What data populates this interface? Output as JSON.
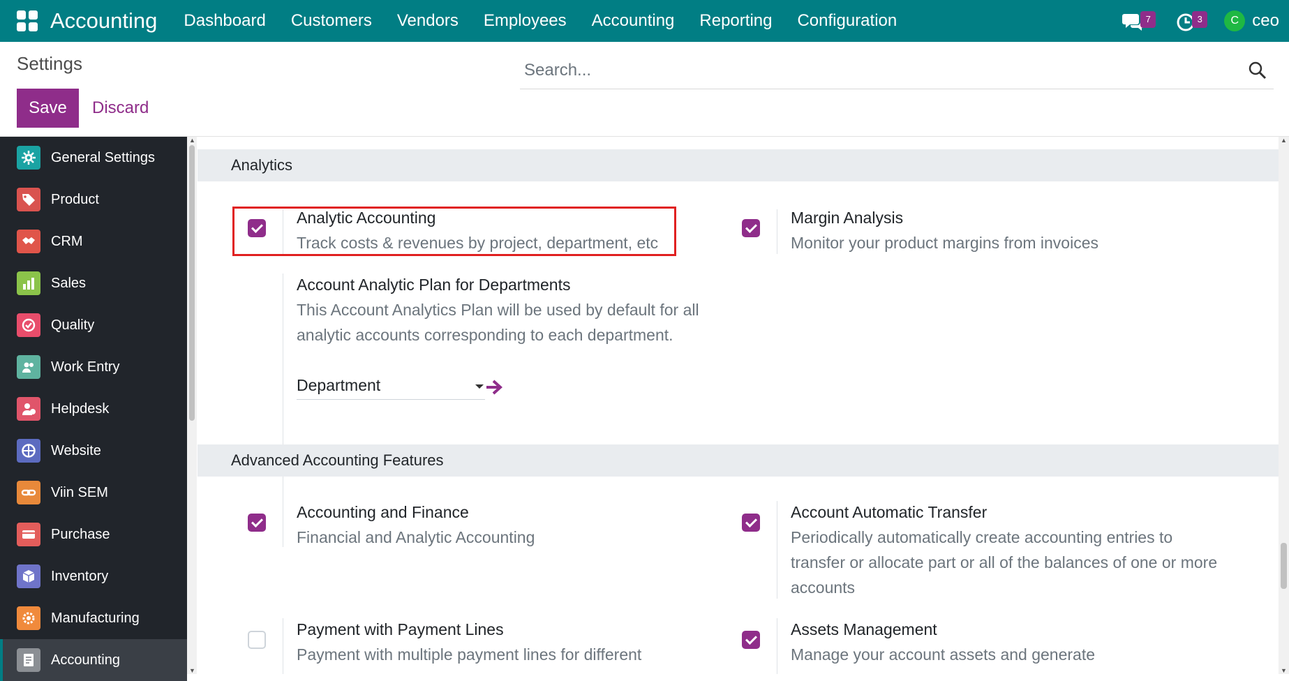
{
  "topbar": {
    "brand": "Accounting",
    "nav": [
      "Dashboard",
      "Customers",
      "Vendors",
      "Employees",
      "Accounting",
      "Reporting",
      "Configuration"
    ],
    "messages_badge": "7",
    "activities_badge": "3",
    "avatar_letter": "C",
    "user_name": "ceo"
  },
  "control": {
    "title": "Settings",
    "save_label": "Save",
    "discard_label": "Discard",
    "search_placeholder": "Search..."
  },
  "sidebar": {
    "items": [
      {
        "label": "General Settings",
        "icon": "gear-icon",
        "color": "#1aa3a3"
      },
      {
        "label": "Product",
        "icon": "tag-icon",
        "color": "#d9534f"
      },
      {
        "label": "CRM",
        "icon": "handshake-icon",
        "color": "#e0554a"
      },
      {
        "label": "Sales",
        "icon": "chart-icon",
        "color": "#8bc34a"
      },
      {
        "label": "Quality",
        "icon": "check-badge-icon",
        "color": "#e84d6b"
      },
      {
        "label": "Work Entry",
        "icon": "people-icon",
        "color": "#5fb3a0"
      },
      {
        "label": "Helpdesk",
        "icon": "support-icon",
        "color": "#e0556a"
      },
      {
        "label": "Website",
        "icon": "globe-icon",
        "color": "#5c6bc0"
      },
      {
        "label": "Viin SEM",
        "icon": "link-icon",
        "color": "#e8893a"
      },
      {
        "label": "Purchase",
        "icon": "card-icon",
        "color": "#e35d5b"
      },
      {
        "label": "Inventory",
        "icon": "box-icon",
        "color": "#6f74c9"
      },
      {
        "label": "Manufacturing",
        "icon": "cog-icon",
        "color": "#f08a3c"
      },
      {
        "label": "Accounting",
        "icon": "invoice-icon",
        "color": "#8b8f94"
      }
    ],
    "active": "Accounting"
  },
  "sections": {
    "analytics": {
      "title": "Analytics",
      "analytic_accounting": {
        "title": "Analytic Accounting",
        "desc": "Track costs & revenues by project, department, etc",
        "checked": true
      },
      "margin_analysis": {
        "title": "Margin Analysis",
        "desc": "Monitor your product margins from invoices",
        "checked": true
      },
      "plan_departments": {
        "title": "Account Analytic Plan for Departments",
        "desc": "This Account Analytics Plan will be used by default for all analytic accounts corresponding to each department.",
        "value": "Department"
      }
    },
    "advanced": {
      "title": "Advanced Accounting Features",
      "accounting_finance": {
        "title": "Accounting and Finance",
        "desc": "Financial and Analytic Accounting",
        "checked": true
      },
      "auto_transfer": {
        "title": "Account Automatic Transfer",
        "desc": "Periodically automatically create accounting entries to transfer or allocate part or all of the balances of one or more accounts",
        "checked": true
      },
      "payment_lines": {
        "title": "Payment with Payment Lines",
        "desc": "Payment with multiple payment lines for different",
        "checked": false
      },
      "assets": {
        "title": "Assets Management",
        "desc": "Manage your account assets and generate",
        "checked": true
      }
    }
  },
  "colors": {
    "topbar": "#017e84",
    "accent": "#8f2d8a",
    "sidebar": "#21252b",
    "highlight": "#e02020"
  }
}
